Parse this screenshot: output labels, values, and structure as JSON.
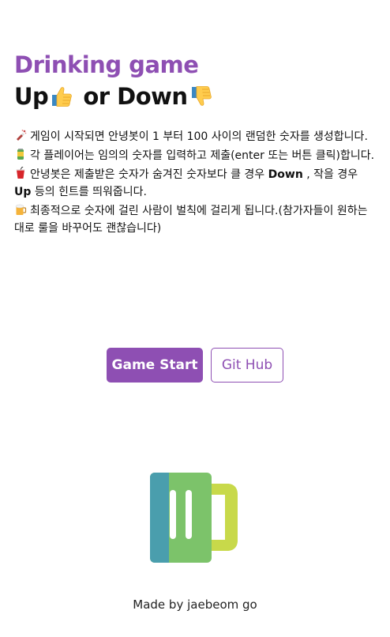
{
  "header": {
    "title": "Drinking game",
    "subtitle_up": "Up",
    "subtitle_or": "or Down",
    "up_icon": "thumbs-up-icon",
    "down_icon": "thumbs-down-icon"
  },
  "rules": [
    {
      "icon": "bottle-popping-icon",
      "text": "게임이 시작되면 안녕봇이 1 부터 100 사이의 랜덤한 숫자를 생성합니다."
    },
    {
      "icon": "beverage-can-icon",
      "text": "각 플레이어는 임의의 숫자를 입력하고 제출(enter 또는 버튼 클릭)합니다."
    },
    {
      "icon": "cup-with-straw-icon",
      "text_before": "안녕봇은 제출받은 숫자가 숨겨진 숫자보다 클 경우 ",
      "bold1": "Down",
      "text_middle": " , 작을 경우 ",
      "bold2": "Up",
      "text_after": " 등의 힌트를 띄워줍니다."
    },
    {
      "icon": "beer-mug-icon",
      "text": "최종적으로 숫자에 걸린 사람이 벌칙에 걸리게 됩니다.(참가자들이 원하는대로 룰을 바꾸어도 괜찮습니다)"
    }
  ],
  "buttons": {
    "start_label": "Game Start",
    "github_label": "Git Hub"
  },
  "illustration": {
    "icon": "beer-mug-logo-icon",
    "colors": {
      "left": "#4a9ead",
      "body": "#7cc36a",
      "handle": "#c8d94a",
      "stripes": "#ffffff"
    }
  },
  "footer": {
    "text": "Made by jaebeom go"
  },
  "theme": {
    "accent": "#8e4fb3"
  }
}
